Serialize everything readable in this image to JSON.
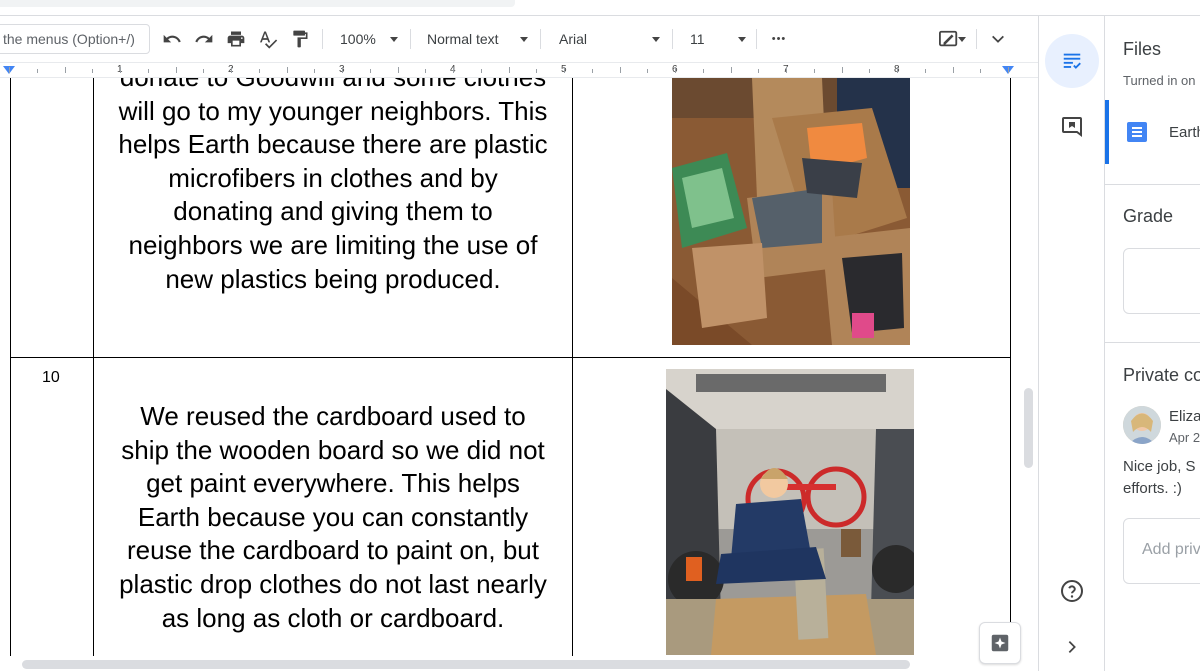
{
  "toolbar": {
    "menu_search": "the menus (Option+/)",
    "zoom": "100%",
    "style": "Normal text",
    "font": "Arial",
    "font_size": "11",
    "more": "•••"
  },
  "ruler": {
    "numbers": [
      "1",
      "2",
      "3",
      "4",
      "5",
      "6",
      "7",
      "8"
    ]
  },
  "table": {
    "row_prev_text": "donate to Goodwill and some clothes\nwill go to my younger neighbors. This\nhelps Earth because there are plastic\nmicrofibers in clothes and by\ndonating and giving them to\nneighbors we are limiting the use of\nnew plastics being produced.",
    "row_10_number": "10",
    "row_10_text": "We reused the cardboard used to\nship the wooden board so we did not\nget paint everywhere. This helps\nEarth because you can constantly\nreuse the cardboard to paint on, but\nplastic drop clothes do not last nearly\nas long as cloth or cardboard."
  },
  "panel": {
    "files_title": "Files",
    "turned_in": "Turned in on",
    "file_name": "Earth",
    "grade_title": "Grade",
    "private_title": "Private comments",
    "commenter": "Eliza",
    "comment_date": "Apr 2",
    "comment_text_1": "Nice job, S",
    "comment_text_2": "efforts. :)",
    "add_placeholder": "Add private comment"
  },
  "colors": {
    "accent": "#1a73e8",
    "rail_active_bg": "#e8f0fe",
    "border": "#dadce0"
  },
  "icons": [
    "undo-icon",
    "redo-icon",
    "print-icon",
    "spellcheck-icon",
    "paint-format-icon",
    "editing-mode-icon",
    "collapse-icon",
    "task-list-icon",
    "comment-icon",
    "help-icon",
    "expand-panel-icon",
    "explore-icon"
  ]
}
